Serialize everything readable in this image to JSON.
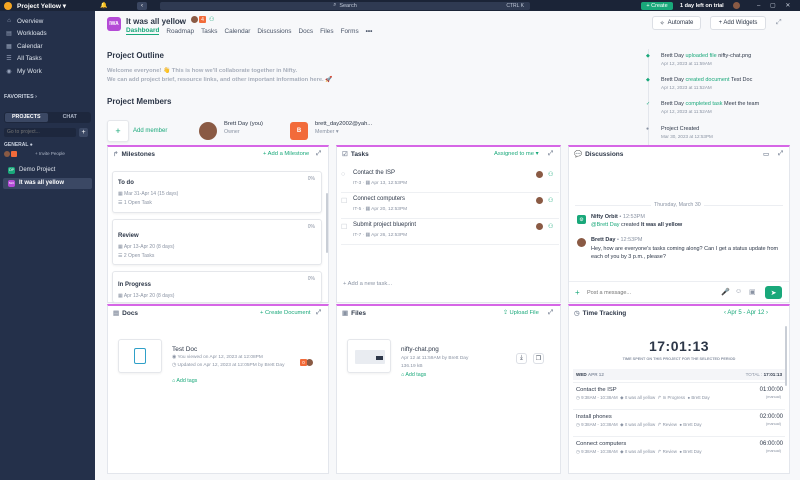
{
  "topbar": {
    "project": "Project Yellow",
    "search": "Search",
    "shortcut": "CTRL K",
    "create": "+ Create",
    "trial": "1 day left on trial"
  },
  "sidebar": {
    "items": [
      "Overview",
      "Workloads",
      "Calendar",
      "All Tasks",
      "My Work"
    ],
    "favorites": "FAVORITES",
    "tab_projects": "PROJECTS",
    "tab_chat": "CHAT",
    "search_placeholder": "Go to project...",
    "general": "GENERAL",
    "invite": "+ Invite People",
    "projects": [
      {
        "badge": "DP",
        "name": "Demo Project"
      },
      {
        "badge": "IWA",
        "name": "It was all yellow"
      }
    ]
  },
  "header": {
    "badge": "IWA",
    "title": "It was all yellow",
    "avatar_count": "4",
    "automate": "Automate",
    "add_widgets": "+ Add Widgets",
    "tabs": [
      "Dashboard",
      "Roadmap",
      "Tasks",
      "Calendar",
      "Discussions",
      "Docs",
      "Files",
      "Forms"
    ]
  },
  "outline": {
    "title": "Project Outline",
    "text1": "Welcome everyone! 👋 This is how we'll collaborate together in Nifty.",
    "text2": "We can add project brief, resource links, and other important information here. 🚀"
  },
  "members": {
    "title": "Project Members",
    "add": "Add member",
    "m1_name": "Brett Day (you)",
    "m1_role": "Owner",
    "m2_name": "brett_day2002@yah...",
    "m2_role": "Member ▾",
    "m2_initial": "B"
  },
  "activity": [
    {
      "who": "Brett Day",
      "action": "uploaded file",
      "obj": "nifty-chat.png",
      "time": "Apr 12, 2023 at 11:59AM"
    },
    {
      "who": "Brett Day",
      "action": "created document",
      "obj": "Test Doc",
      "time": "Apr 12, 2023 at 11:52AM"
    },
    {
      "who": "Brett Day",
      "action": "completed task",
      "obj": "Meet the team",
      "time": "Apr 12, 2023 at 11:52AM"
    },
    {
      "who": "Project Created",
      "action": "",
      "obj": "",
      "time": "Mar 30, 2023 at 12:53PM"
    }
  ],
  "milestones": {
    "title": "Milestones",
    "add": "+ Add a Milestone",
    "items": [
      {
        "name": "To do",
        "pct": "0%",
        "dates": "Mar 31-Apr 14 (15 days)",
        "tasks": "1 Open Task"
      },
      {
        "name": "Review",
        "pct": "0%",
        "dates": "Apr 13-Apr 20 (8 days)",
        "tasks": "2 Open Tasks"
      },
      {
        "name": "In Progress",
        "pct": "0%",
        "dates": "Apr 13-Apr 20 (8 days)",
        "tasks": ""
      }
    ]
  },
  "tasks": {
    "title": "Tasks",
    "filter": "Assigned to me ▾",
    "add": "+ Add a new task...",
    "items": [
      {
        "name": "Contact the ISP",
        "id": "IT-3",
        "date": "Apr 13, 12:53PM"
      },
      {
        "name": "Connect computers",
        "id": "IT-5",
        "date": "Apr 20, 12:53PM"
      },
      {
        "name": "Submit project blueprint",
        "id": "IT-7",
        "date": "Apr 26, 12:53PM"
      }
    ]
  },
  "discussions": {
    "title": "Discussions",
    "date": "Thursday, March 30",
    "bot_name": "Nifty Orbit",
    "bot_time": "12:53PM",
    "bot_text1": "@Brett Day",
    "bot_text2": "created",
    "bot_text3": "It was all yellow",
    "user_name": "Brett Day",
    "user_time": "12:53PM",
    "user_text": "Hey, how are everyone's tasks coming along? Can I get a status update from each of you by 3 p.m., please?",
    "placeholder": "Post a message..."
  },
  "docs": {
    "title": "Docs",
    "add": "+ Create Document",
    "name": "Test Doc",
    "viewed": "You viewed on Apr 12, 2023 at 12:08PM",
    "updated": "Updated on Apr 12, 2023 at 12:05PM by Brett Day",
    "tags": "Add tags",
    "count": "0"
  },
  "files": {
    "title": "Files",
    "upload": "Upload File",
    "name": "nifty-chat.png",
    "meta1": "Apr 12 at 11:59AM by Brett Day",
    "meta2": "136.19 kB",
    "tags": "Add tags"
  },
  "time": {
    "title": "Time Tracking",
    "range": "Apr 5 - Apr 12",
    "clock": "17:01:13",
    "sub": "TIME SPENT ON THIS PROJECT FOR THE SELECTED PERIOD",
    "day": "WED",
    "day_date": "APR 12",
    "total_label": "TOTAL :",
    "total": "17:01:13",
    "entries": [
      {
        "name": "Contact the ISP",
        "dur": "01:00:00",
        "meta": "9:38AM - 10:38AM",
        "proj": "It was all yellow",
        "ms": "In Progress",
        "who": "Brett Day",
        "manual": "(manual)"
      },
      {
        "name": "Install phones",
        "dur": "02:00:00",
        "meta": "9:38AM - 10:38AM",
        "proj": "It was all yellow",
        "ms": "Review",
        "who": "Brett Day",
        "manual": "(manual)"
      },
      {
        "name": "Connect computers",
        "dur": "06:00:00",
        "meta": "9:38AM - 10:38AM",
        "proj": "It was all yellow",
        "ms": "Review",
        "who": "Brett Day",
        "manual": "(manual)"
      }
    ]
  },
  "colors": {
    "accent": "#19a87a",
    "panel_top": "#d666e6",
    "sidebar": "#24304a",
    "topbar": "#1b2437",
    "badge": "#b44bd6",
    "orange": "#f26b3a"
  }
}
